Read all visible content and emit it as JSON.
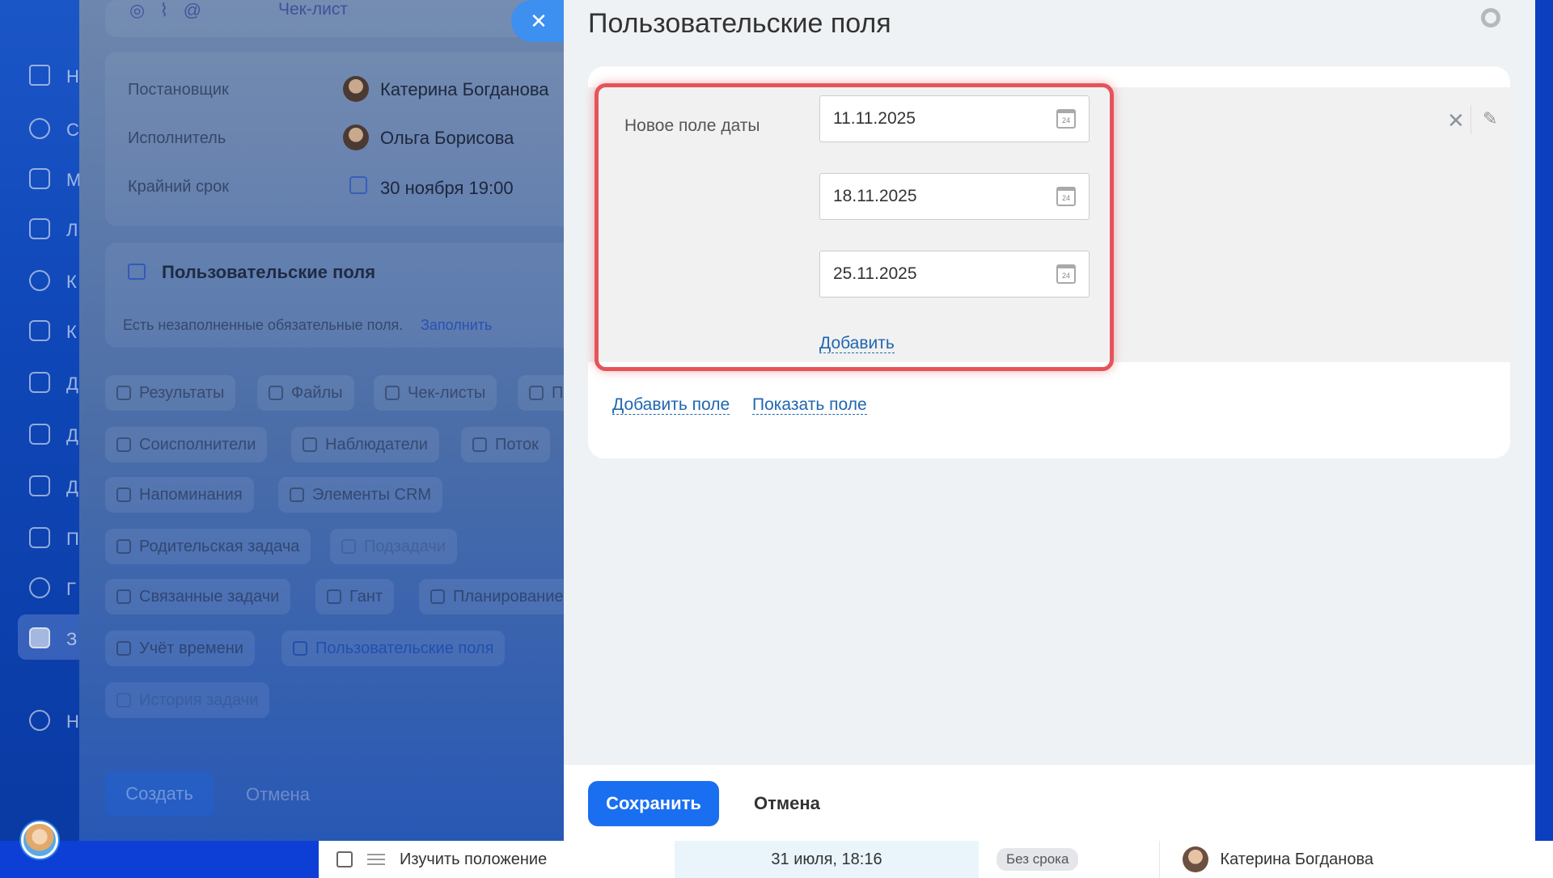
{
  "sidebar": {
    "items": [
      {
        "icon": "home-icon",
        "label": "Н"
      },
      {
        "icon": "collab-icon",
        "label": "С"
      },
      {
        "icon": "chat-icon",
        "label": "М"
      },
      {
        "icon": "feed-icon",
        "label": "Л"
      },
      {
        "icon": "cube-icon",
        "label": "К"
      },
      {
        "icon": "calendar-icon",
        "label": "К"
      },
      {
        "icon": "drive-icon",
        "label": "Д"
      },
      {
        "icon": "doc-icon",
        "label": "Д"
      },
      {
        "icon": "board-icon",
        "label": "Д"
      },
      {
        "icon": "mail-icon",
        "label": "П"
      },
      {
        "icon": "group-icon",
        "label": "Г"
      },
      {
        "icon": "tasks-icon",
        "label": "З"
      },
      {
        "icon": "settings-icon",
        "label": "Н"
      }
    ]
  },
  "task_form": {
    "toolbar_checklist": "Чек-лист",
    "creator_label": "Постановщик",
    "creator_name": "Катерина Богданова",
    "assignee_label": "Исполнитель",
    "assignee_name": "Ольга Борисова",
    "deadline_label": "Крайний срок",
    "deadline_value": "30 ноября 19:00",
    "custom_fields_title": "Пользовательские поля",
    "notice_text": "Есть незаполненные обязательные поля.",
    "notice_link": "Заполнить",
    "chips": [
      "Результаты",
      "Файлы",
      "Чек-листы",
      "П",
      "Соисполнители",
      "Наблюдатели",
      "Поток",
      "Напоминания",
      "Элементы CRM",
      "Родительская задача",
      "Подзадачи",
      "Связанные задачи",
      "Гант",
      "Планирование",
      "Учёт времени",
      "Пользовательские поля",
      "История задачи"
    ],
    "create_button": "Создать",
    "cancel_button": "Отмена"
  },
  "panel": {
    "title": "Пользовательские поля",
    "field_label": "Новое поле даты",
    "dates": [
      "11.11.2025",
      "18.11.2025",
      "25.11.2025"
    ],
    "calendar_day": "24",
    "add_value_link": "Добавить",
    "add_field_link": "Добавить поле",
    "show_field_link": "Показать поле",
    "save_button": "Сохранить",
    "cancel_button": "Отмена"
  },
  "task_list_row": {
    "title": "Изучить положение",
    "date": "31 июля, 18:16",
    "badge": "Без срока",
    "responsible": "Катерина Богданова"
  },
  "colors": {
    "accent": "#1a6ff0",
    "link": "#2067b0",
    "highlight": "#e5545b"
  }
}
